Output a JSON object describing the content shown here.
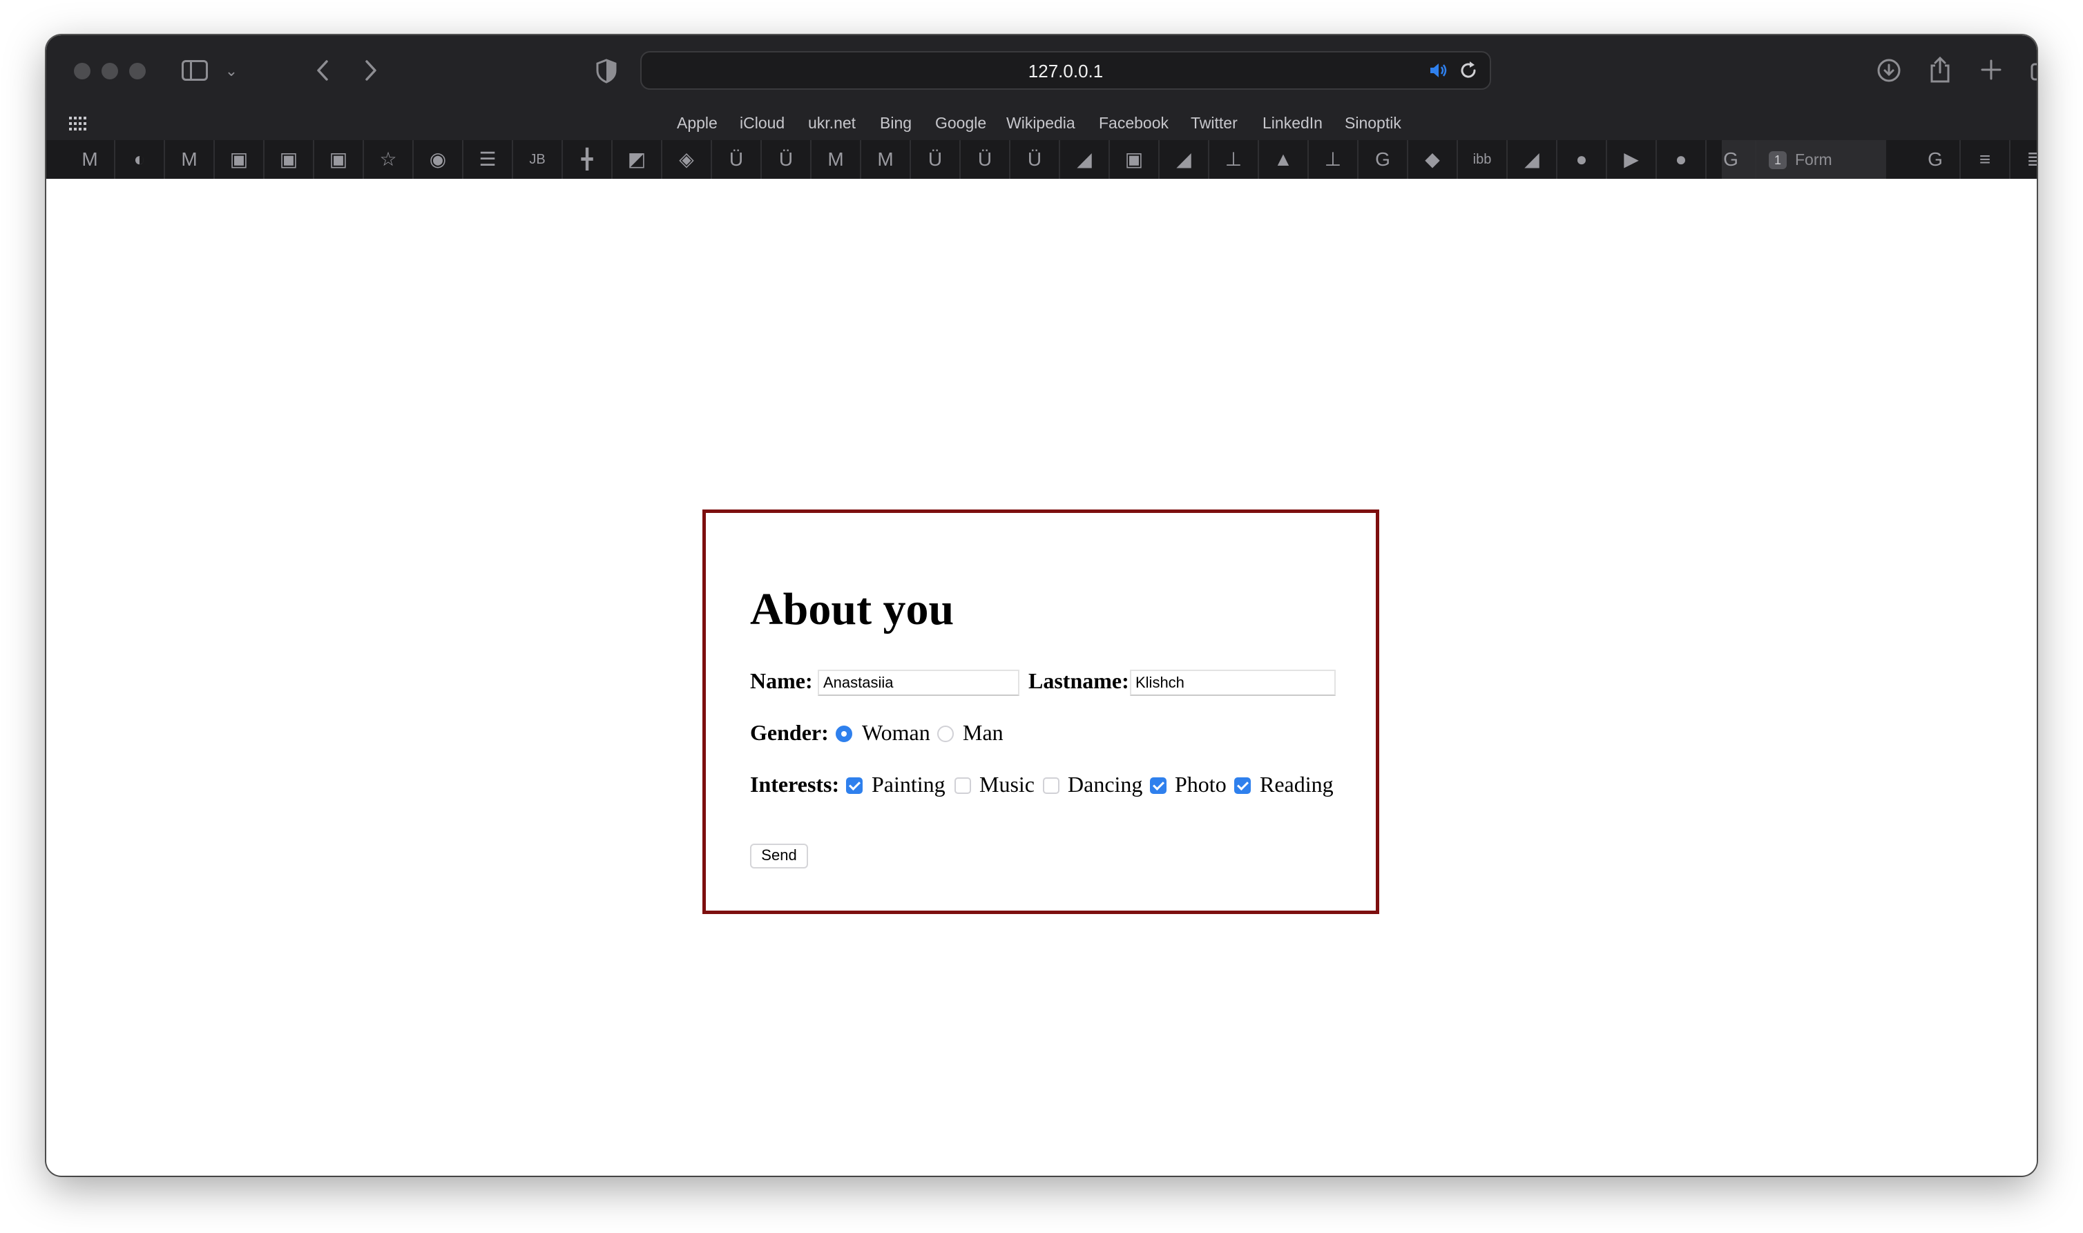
{
  "browser": {
    "url": "127.0.0.1",
    "favorites": [
      "Apple",
      "iCloud",
      "ukr.net",
      "Bing",
      "Google",
      "Wikipedia",
      "Facebook",
      "Twitter",
      "LinkedIn",
      "Sinoptik"
    ],
    "active_tab": {
      "badge": "1",
      "title": "Form"
    },
    "pinned_tab_icons": [
      {
        "name": "gmail-icon",
        "glyph": "M"
      },
      {
        "name": "pacman-icon",
        "glyph": "◐"
      },
      {
        "name": "gmail-icon",
        "glyph": "M"
      },
      {
        "name": "app-icon",
        "glyph": "▣"
      },
      {
        "name": "app-icon",
        "glyph": "▣"
      },
      {
        "name": "app-icon",
        "glyph": "▣"
      },
      {
        "name": "star-icon",
        "glyph": "☆"
      },
      {
        "name": "app-icon",
        "glyph": "◉"
      },
      {
        "name": "list-icon",
        "glyph": "☰"
      },
      {
        "name": "jetbrains-icon",
        "glyph": "JB"
      },
      {
        "name": "grid-icon",
        "glyph": "╋"
      },
      {
        "name": "app-icon",
        "glyph": "◩"
      },
      {
        "name": "app-icon",
        "glyph": "◈"
      },
      {
        "name": "udemy-icon",
        "glyph": "Ü"
      },
      {
        "name": "udemy-icon",
        "glyph": "Ü"
      },
      {
        "name": "gmail-icon",
        "glyph": "M"
      },
      {
        "name": "gmail-icon",
        "glyph": "M"
      },
      {
        "name": "udemy-icon",
        "glyph": "Ü"
      },
      {
        "name": "udemy-icon",
        "glyph": "Ü"
      },
      {
        "name": "udemy-icon",
        "glyph": "Ü"
      },
      {
        "name": "app-icon",
        "glyph": "◢"
      },
      {
        "name": "app-icon",
        "glyph": "▣"
      },
      {
        "name": "app-icon",
        "glyph": "◢"
      },
      {
        "name": "app-icon",
        "glyph": "⊥"
      },
      {
        "name": "app-icon",
        "glyph": "▲"
      },
      {
        "name": "app-icon",
        "glyph": "⊥"
      },
      {
        "name": "google-icon",
        "glyph": "G"
      },
      {
        "name": "app-icon",
        "glyph": "◆"
      },
      {
        "name": "app-icon",
        "glyph": "ibb"
      },
      {
        "name": "app-icon",
        "glyph": "◢"
      },
      {
        "name": "github-icon",
        "glyph": "●"
      },
      {
        "name": "youtube-icon",
        "glyph": "▶"
      },
      {
        "name": "github-icon",
        "glyph": "●"
      },
      {
        "name": "google-icon",
        "glyph": "G"
      }
    ],
    "right_tab_icons": [
      {
        "name": "google-icon",
        "glyph": "G"
      },
      {
        "name": "stackoverflow-icon",
        "glyph": "≡"
      },
      {
        "name": "app-icon",
        "glyph": "≣"
      }
    ]
  },
  "form": {
    "title": "About you",
    "name_label": "Name:",
    "name_value": "Anastasiia",
    "lastname_label": "Lastname:",
    "lastname_value": "Klishch",
    "gender_label": "Gender:",
    "gender_options": [
      {
        "label": "Woman",
        "selected": true
      },
      {
        "label": "Man",
        "selected": false
      }
    ],
    "interests_label": "Interests:",
    "interests": [
      {
        "label": "Painting",
        "checked": true
      },
      {
        "label": "Music",
        "checked": false
      },
      {
        "label": "Dancing",
        "checked": false
      },
      {
        "label": "Photo",
        "checked": true
      },
      {
        "label": "Reading",
        "checked": true
      }
    ],
    "send_label": "Send",
    "border_color": "#7d0f0f",
    "accent_color": "#2f80ed"
  }
}
